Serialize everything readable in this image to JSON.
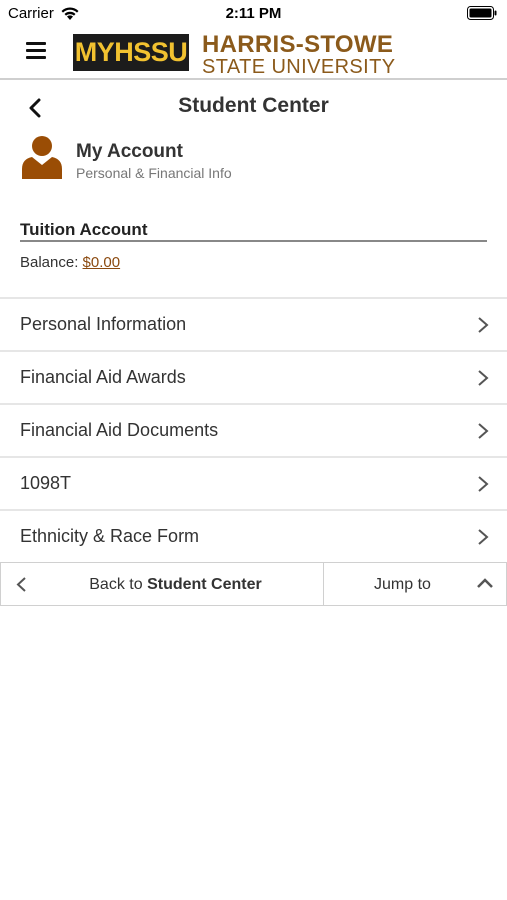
{
  "status_bar": {
    "carrier": "Carrier",
    "time": "2:11 PM"
  },
  "header": {
    "logo_badge": "MYHSSU",
    "logo_line1": "HARRIS-STOWE",
    "logo_line2": "STATE UNIVERSITY",
    "brand_color": "#8b5a1b",
    "badge_color": "#f2c230"
  },
  "page": {
    "title": "Student Center"
  },
  "account": {
    "title": "My Account",
    "subtitle": "Personal & Financial Info"
  },
  "tuition": {
    "title": "Tuition Account",
    "balance_label": "Balance:",
    "balance_value": "$0.00"
  },
  "menu": {
    "items": [
      {
        "label": "Personal Information"
      },
      {
        "label": "Financial Aid Awards"
      },
      {
        "label": "Financial Aid Documents"
      },
      {
        "label": "1098T"
      },
      {
        "label": "Ethnicity & Race Form"
      }
    ]
  },
  "bottom_bar": {
    "back_prefix": "Back to",
    "back_target": "Student Center",
    "jump_label": "Jump to"
  }
}
